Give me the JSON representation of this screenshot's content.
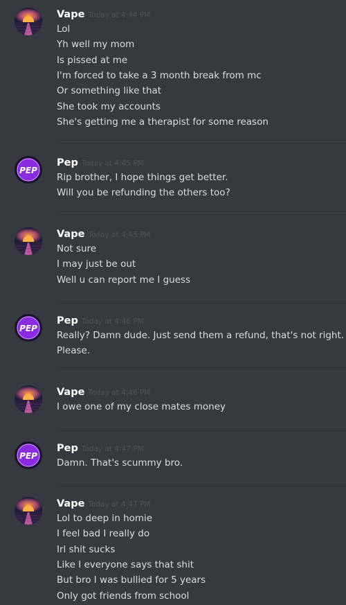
{
  "messages": [
    {
      "user": "Vape",
      "time": "Today at 4:44 PM",
      "avatar": "sunset-avatar",
      "lines": [
        "Lol",
        "Yh well my mom",
        "Is pissed at me",
        "I'm forced to take a 3 month break from mc",
        "Or something like that",
        "She took my accounts",
        "She's getting me a therapist for some reason"
      ]
    },
    {
      "user": "Pep",
      "time": "Today at 4:45 PM",
      "avatar": "pep-logo-avatar",
      "lines": [
        "Rip brother, I hope things get better.",
        "Will you be refunding the others too?"
      ]
    },
    {
      "user": "Vape",
      "time": "Today at 4:45 PM",
      "avatar": "sunset-avatar",
      "lines": [
        "Not sure",
        "I may just be out",
        "Well u can report me I guess"
      ]
    },
    {
      "user": "Pep",
      "time": "Today at 4:46 PM",
      "avatar": "pep-logo-avatar",
      "lines": [
        "Really? Damn dude. Just send them a refund, that's not right.",
        "Please."
      ]
    },
    {
      "user": "Vape",
      "time": "Today at 4:46 PM",
      "avatar": "sunset-avatar",
      "lines": [
        "I owe one of my close mates money"
      ]
    },
    {
      "user": "Pep",
      "time": "Today at 4:47 PM",
      "avatar": "pep-logo-avatar",
      "lines": [
        "Damn. That's scummy bro."
      ]
    },
    {
      "user": "Vape",
      "time": "Today at 4:47 PM",
      "avatar": "sunset-avatar",
      "lines": [
        "Lol to deep in homie",
        "I feel bad I really do",
        "Irl shit sucks",
        "Like I everyone says that shit",
        "But bro I was bullied for 5 years",
        "Only got friends from school"
      ]
    }
  ],
  "avatar_label": "PEP",
  "colors": {
    "background": "#36393f",
    "username": "#ffffff",
    "timestamp": "#4f5258",
    "text": "#dcddde",
    "divider": "#3f4249",
    "pep_purple": "#8a2be2"
  }
}
